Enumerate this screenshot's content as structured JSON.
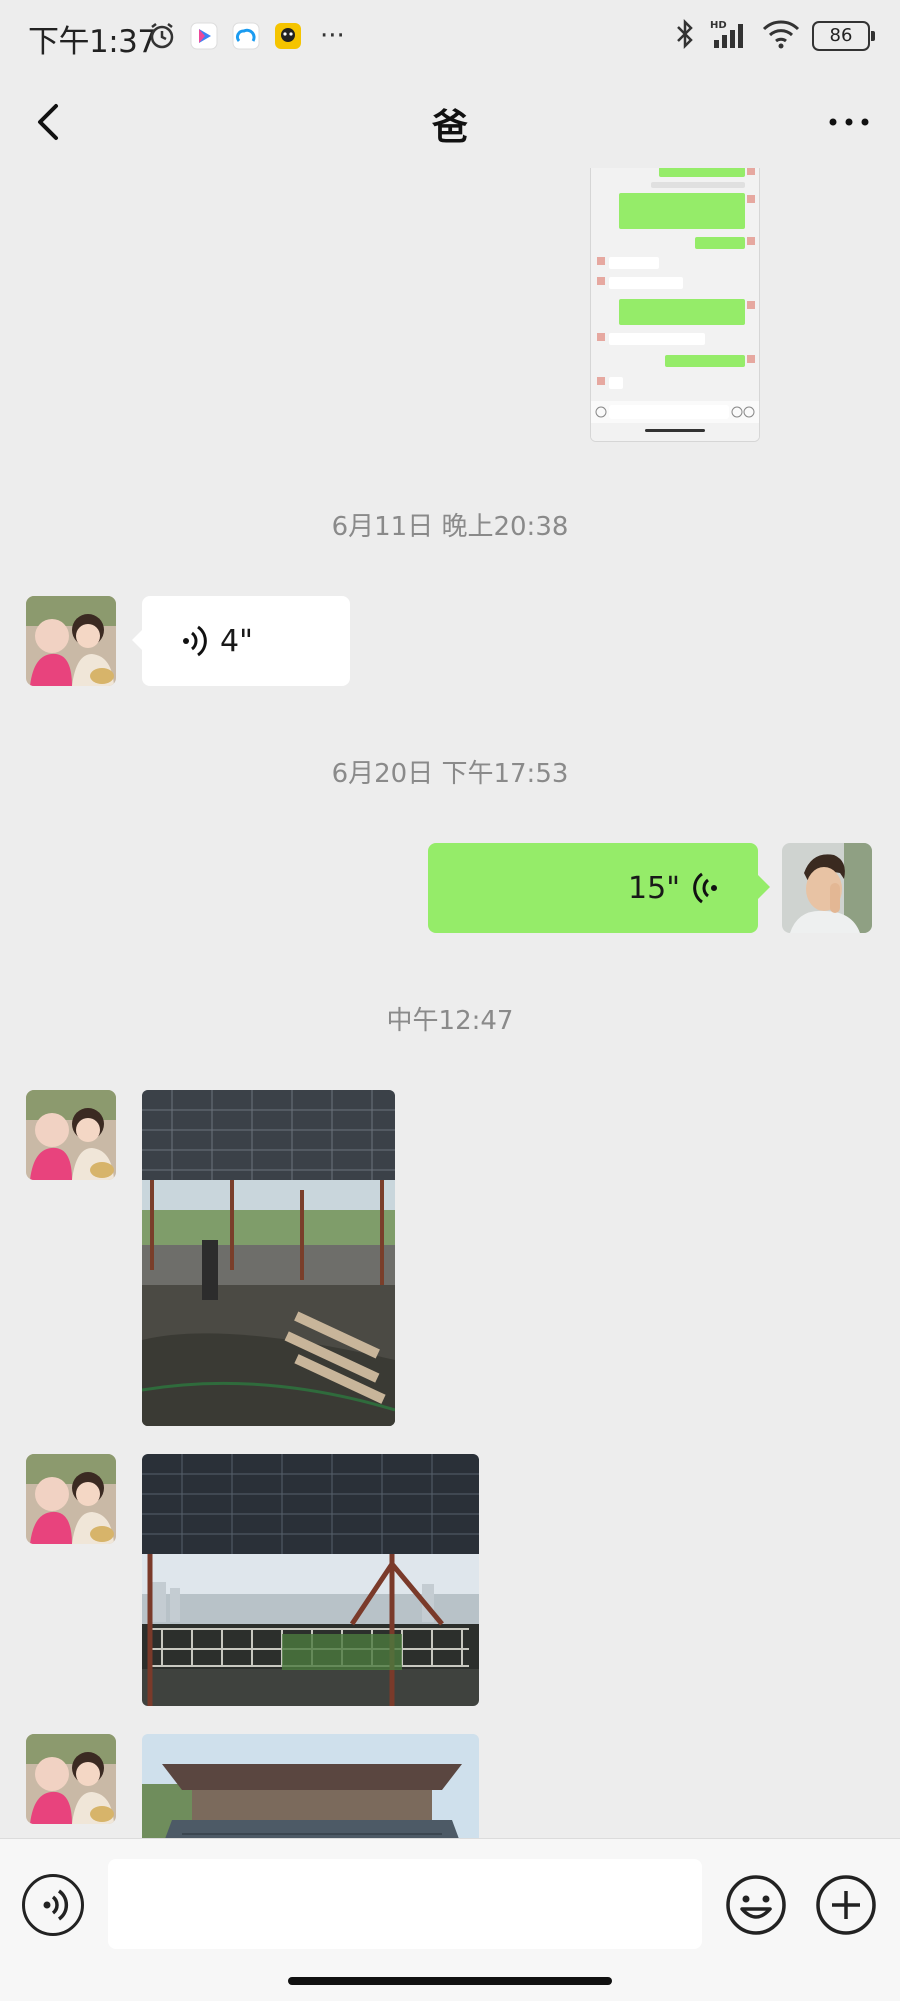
{
  "status_bar": {
    "time": "下午1:37",
    "battery": "86",
    "icons_left": [
      "alarm-icon",
      "play-app-icon",
      "cloud-app-icon",
      "game-app-icon"
    ],
    "overflow": "···",
    "icons_right": [
      "bluetooth-icon",
      "hd-signal-icon",
      "wifi-icon",
      "battery-icon"
    ],
    "signal_label": "HD"
  },
  "nav": {
    "title": "爸",
    "back_icon": "chevron-left-icon",
    "more_icon": "more-dots-icon"
  },
  "messages": [
    {
      "type": "image",
      "direction": "out",
      "content": "chat-screenshot"
    },
    {
      "type": "timestamp",
      "text": "6月11日 晚上20:38"
    },
    {
      "type": "voice",
      "direction": "in",
      "duration": "4\""
    },
    {
      "type": "timestamp",
      "text": "6月20日 下午17:53"
    },
    {
      "type": "voice",
      "direction": "out",
      "duration": "15\""
    },
    {
      "type": "timestamp",
      "text": "中午12:47"
    },
    {
      "type": "image",
      "direction": "in",
      "content": "rooftop-solar-panels-photo"
    },
    {
      "type": "image",
      "direction": "in",
      "content": "rooftop-railing-photo"
    },
    {
      "type": "image",
      "direction": "in",
      "content": "rooftop-roof-photo"
    }
  ],
  "input_bar": {
    "placeholder": "",
    "voice_icon": "voice-icon",
    "emoji_icon": "emoji-icon",
    "plus_icon": "plus-icon"
  },
  "colors": {
    "background": "#ededed",
    "outgoing_bubble": "#95ec69",
    "incoming_bubble": "#ffffff",
    "timestamp": "#8a8a8a"
  }
}
